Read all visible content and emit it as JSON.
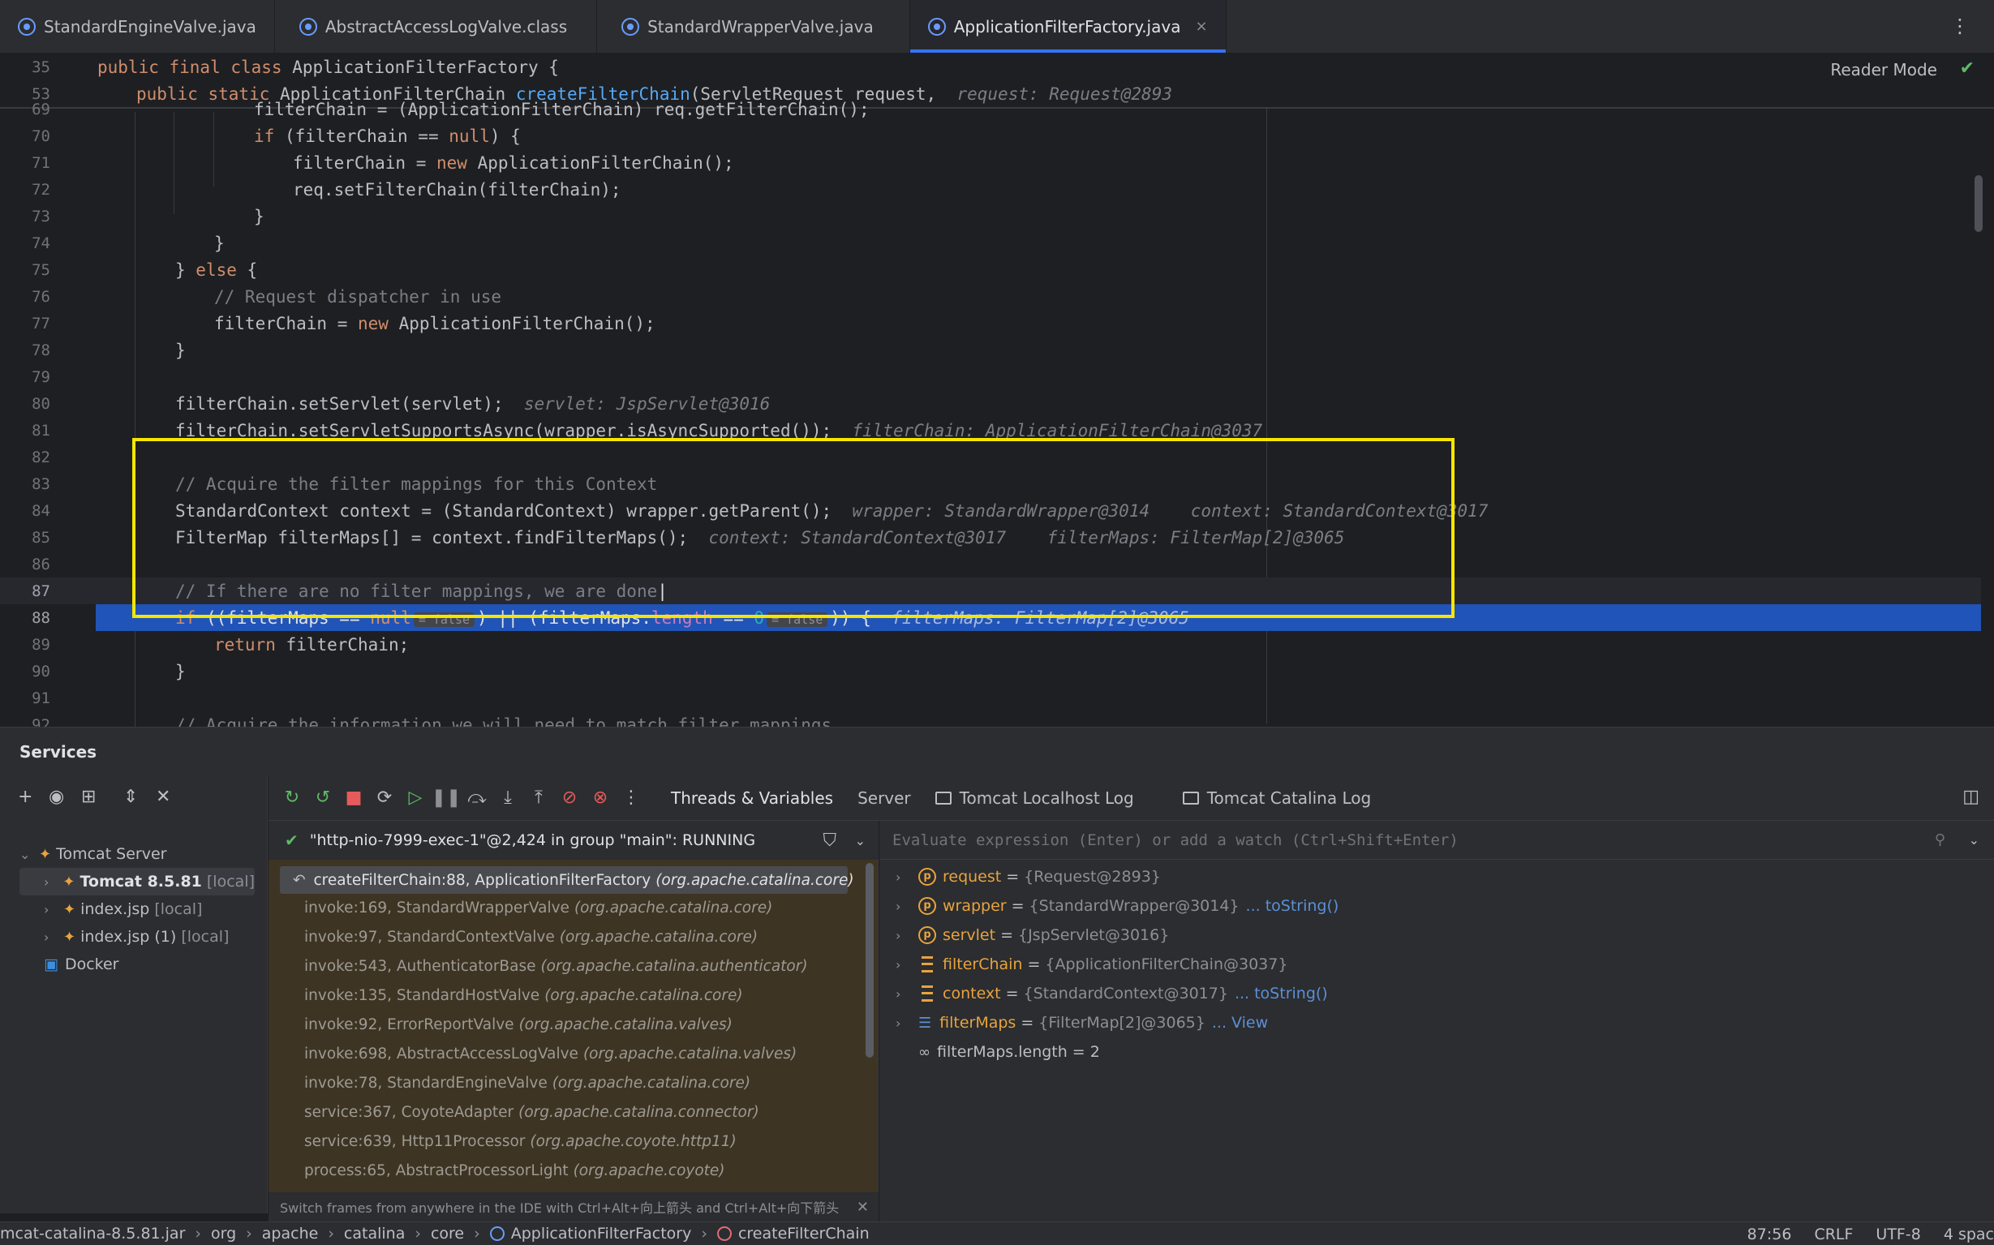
{
  "tabs": [
    {
      "label": "StandardEngineValve.java",
      "active": false
    },
    {
      "label": "AbstractAccessLogValve.class",
      "active": false
    },
    {
      "label": "StandardWrapperValve.java",
      "active": false
    },
    {
      "label": "ApplicationFilterFactory.java",
      "active": true
    }
  ],
  "tab_close": "×",
  "tab_more": "⋮",
  "editor": {
    "reader_mode": "Reader Mode",
    "sticky": [
      {
        "ln": "35",
        "kw": "public final class ",
        "name": "ApplicationFilterFactory {"
      },
      {
        "ln": "53",
        "kw": "public static ",
        "type": "ApplicationFilterChain ",
        "fn": "createFilterChain",
        "rest": "(ServletRequest request,",
        "hint": "request: Request@2893"
      }
    ],
    "lines": {
      "l69": {
        "ln": "69",
        "text": "filterChain = (ApplicationFilterChain) req.getFilterChain();"
      },
      "l70": {
        "ln": "70",
        "a": "if ",
        "b": "(filterChain == ",
        "c": "null",
        "d": ") {"
      },
      "l71": {
        "ln": "71",
        "a": "filterChain = ",
        "b": "new ",
        "c": "ApplicationFilterChain();"
      },
      "l72": {
        "ln": "72",
        "text": "req.setFilterChain(filterChain);"
      },
      "l73": {
        "ln": "73",
        "text": "}"
      },
      "l74": {
        "ln": "74",
        "text": "}"
      },
      "l75": {
        "ln": "75",
        "a": "} ",
        "b": "else",
        "c": " {"
      },
      "l76": {
        "ln": "76",
        "text": "// Request dispatcher in use"
      },
      "l77": {
        "ln": "77",
        "a": "filterChain = ",
        "b": "new ",
        "c": "ApplicationFilterChain();"
      },
      "l78": {
        "ln": "78",
        "text": "}"
      },
      "l79": {
        "ln": "79"
      },
      "l80": {
        "ln": "80",
        "text": "filterChain.setServlet(servlet);",
        "hint": "servlet: JspServlet@3016"
      },
      "l81": {
        "ln": "81",
        "text": "filterChain.setServletSupportsAsync(wrapper.isAsyncSupported());",
        "hint": "filterChain: ApplicationFilterChain@3037"
      },
      "l82": {
        "ln": "82"
      },
      "l83": {
        "ln": "83",
        "text": "// Acquire the filter mappings for this Context"
      },
      "l84": {
        "ln": "84",
        "text": "StandardContext context = (StandardContext) wrapper.getParent();",
        "hint1": "wrapper: StandardWrapper@3014",
        "hint2": "context: StandardContext@3017"
      },
      "l85": {
        "ln": "85",
        "text": "FilterMap filterMaps[] = context.findFilterMaps();",
        "hint1": "context: StandardContext@3017",
        "hint2": "filterMaps: FilterMap[2]@3065"
      },
      "l86": {
        "ln": "86"
      },
      "l87": {
        "ln": "87",
        "text": "// If there are no filter mappings, we are done"
      },
      "l88": {
        "ln": "88",
        "a": "if ",
        "b": "((filterMaps == ",
        "c": "null",
        "pill1": "= false",
        "d": ") || (filterMaps.",
        "e": "length",
        "f": " == ",
        "g": "0",
        "pill2": "= false",
        "h": ")) {",
        "hint": "filterMaps: FilterMap[2]@3065"
      },
      "l89": {
        "ln": "89",
        "a": "return ",
        "b": "filterChain;"
      },
      "l90": {
        "ln": "90",
        "text": "}"
      },
      "l91": {
        "ln": "91"
      },
      "l92": {
        "ln": "92",
        "text": "// Acquire the information we will need to match filter mappings"
      }
    }
  },
  "services": {
    "title": "Services",
    "tree": {
      "root": "Tomcat Server",
      "items": [
        {
          "label": "Tomcat 8.5.81",
          "suffix": "[local]"
        },
        {
          "label": "index.jsp",
          "suffix": "[local]"
        },
        {
          "label": "index.jsp (1)",
          "suffix": "[local]"
        }
      ],
      "docker": "Docker"
    }
  },
  "debug": {
    "tabs": [
      "Threads & Variables",
      "Server",
      "Tomcat Localhost Log",
      "Tomcat Catalina Log"
    ],
    "thread": "\"http-nio-7999-exec-1\"@2,424 in group \"main\": RUNNING",
    "frames": [
      {
        "method": "createFilterChain:88, ApplicationFilterFactory",
        "pkg": "(org.apache.catalina.core)"
      },
      {
        "method": "invoke:169, StandardWrapperValve",
        "pkg": "(org.apache.catalina.core)"
      },
      {
        "method": "invoke:97, StandardContextValve",
        "pkg": "(org.apache.catalina.core)"
      },
      {
        "method": "invoke:543, AuthenticatorBase",
        "pkg": "(org.apache.catalina.authenticator)"
      },
      {
        "method": "invoke:135, StandardHostValve",
        "pkg": "(org.apache.catalina.core)"
      },
      {
        "method": "invoke:92, ErrorReportValve",
        "pkg": "(org.apache.catalina.valves)"
      },
      {
        "method": "invoke:698, AbstractAccessLogValve",
        "pkg": "(org.apache.catalina.valves)"
      },
      {
        "method": "invoke:78, StandardEngineValve",
        "pkg": "(org.apache.catalina.core)"
      },
      {
        "method": "service:367, CoyoteAdapter",
        "pkg": "(org.apache.catalina.connector)"
      },
      {
        "method": "service:639, Http11Processor",
        "pkg": "(org.apache.coyote.http11)"
      },
      {
        "method": "process:65, AbstractProcessorLight",
        "pkg": "(org.apache.coyote)"
      }
    ],
    "frames_hint": "Switch frames from anywhere in the IDE with Ctrl+Alt+向上箭头 and Ctrl+Alt+向下箭头",
    "eval_placeholder": "Evaluate expression (Enter) or add a watch (Ctrl+Shift+Enter)",
    "variables": [
      {
        "name": "request",
        "value": "{Request@2893}",
        "link": ""
      },
      {
        "name": "wrapper",
        "value": "{StandardWrapper@3014}",
        "link": "... toString()"
      },
      {
        "name": "servlet",
        "value": "{JspServlet@3016}",
        "link": ""
      },
      {
        "name": "filterChain",
        "value": "{ApplicationFilterChain@3037}",
        "link": ""
      },
      {
        "name": "context",
        "value": "{StandardContext@3017}",
        "link": "... toString()"
      },
      {
        "name": "filterMaps",
        "value": "{FilterMap[2]@3065}",
        "link": "... View"
      },
      {
        "name": "filterMaps.length",
        "value": "2",
        "link": ""
      }
    ]
  },
  "statusbar": {
    "crumbs": [
      "mcat-catalina-8.5.81.jar",
      "org",
      "apache",
      "catalina",
      "core",
      "ApplicationFilterFactory",
      "createFilterChain"
    ],
    "position": "87:56",
    "line_sep": "CRLF",
    "encoding": "UTF-8",
    "indent": "4 spac"
  }
}
